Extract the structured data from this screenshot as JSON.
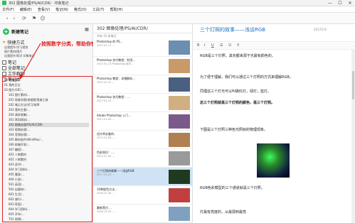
{
  "window": {
    "title": "302 图像处理/PS/AI/CDR/ · 印象笔记",
    "controls": [
      "—",
      "☐",
      "✕"
    ]
  },
  "menu": [
    "文件(F)",
    "编辑(E)",
    "查看(V)",
    "笔记(N)",
    "格式(O)",
    "工具(T)",
    "帮助(H)"
  ],
  "sidebar": {
    "new_note": "新建笔记",
    "shortcuts_label": "快捷方式",
    "shortcut_items": [
      "自我提升/学习规划",
      "图片素材/图片",
      "自我提升/知识 印象笔记"
    ],
    "notes_label": "笔记",
    "all_notes_label": "全部笔记",
    "workchat_label": "工作群聊",
    "notebooks_label": "笔记本",
    "tree": [
      "00 待整理",
      "01 我的日记",
      "02 图片/GIF/...",
      "101 图片素材/...",
      "201 思维导图/流程图/思维工具",
      "202 笔记方法/学习/效率",
      "203 我的主意/...",
      "204 请求收集/...",
      "301 常用网站/...",
      "302 图像处理/PS/AI/CDR/",
      "303 视频处理/...",
      "304 音频处理/...",
      "305 数码软件/Win/Mac/...",
      "306 前端开发/...",
      "307 编程/...",
      "401 人物素材",
      "402 人物素材",
      "403 读书/...",
      "404 学习资料/...",
      "405 健身/...",
      "406 小说/...",
      "501 英语/...",
      "502 自媒体/...",
      "601 生活/...",
      "602 旅行/...",
      "603 家居/...",
      "604 学习资料/...",
      "605 开车/...",
      "701 视频/..."
    ],
    "selected_index": 9,
    "annotation": "按照数字分类，帮助你快速查找笔记本"
  },
  "notelist": {
    "header": "302 图像处理/PS/AI/CDR/",
    "subheader": "共有 32 条笔记",
    "notes": [
      {
        "title": "Photoshop 的 PS...",
        "desc": "2017-01-17 ..."
      },
      {
        "title": "Photoshop 技巧教程：利用...",
        "desc": "2017-01-13 Photoshop 技巧..."
      },
      {
        "title": "Photoshop 教程：详细解析...",
        "desc": "2017-01-12 ..."
      },
      {
        "title": "Photoshop 技巧教程：...",
        "desc": "2017-01-10 ..."
      },
      {
        "title": "Adobe Photoshop 入门...",
        "desc": "2017-01-09 ..."
      },
      {
        "title": "设计师必备的..",
        "desc": "2017-01-08 ..."
      },
      {
        "title": "色彩知识：....",
        "desc": "2017-01-05 ..."
      },
      {
        "title": "三个灯照的故事——浅谈RGB",
        "desc": "2017-01-03 ..."
      },
      {
        "title": "10种配色方法...",
        "desc": "2016-12-28 ..."
      },
      {
        "title": "最新黑白 ...",
        "desc": "2016-12-20 ..."
      }
    ],
    "selected_index": 7
  },
  "editor": {
    "title": "三个灯照的故事——浅谈RGB",
    "meta": "2017/1/3",
    "paragraphs": [
      "RGB是三个灯照，其实都来源于光最有颜色的。",
      "为了便于理解，我们可以通过三个灯照的方式来理解RGB。",
      "同理这三个灯光可以叫做红灯，绿灯，蓝灯。",
      "这三个灯照就是三个灯照的颜色，是三个灯照。",
      "下图是三个灯照三种色光照射的物理现象。",
      "RGB色彩模型的三个通道就是三个灯照。",
      "灯最有亮度的，从最弱到最亮"
    ]
  },
  "colors": {
    "accent": "#2dbe60",
    "selection": "#cfe3f5",
    "annotation": "#e02020",
    "title_blue": "#1a6fc4"
  }
}
